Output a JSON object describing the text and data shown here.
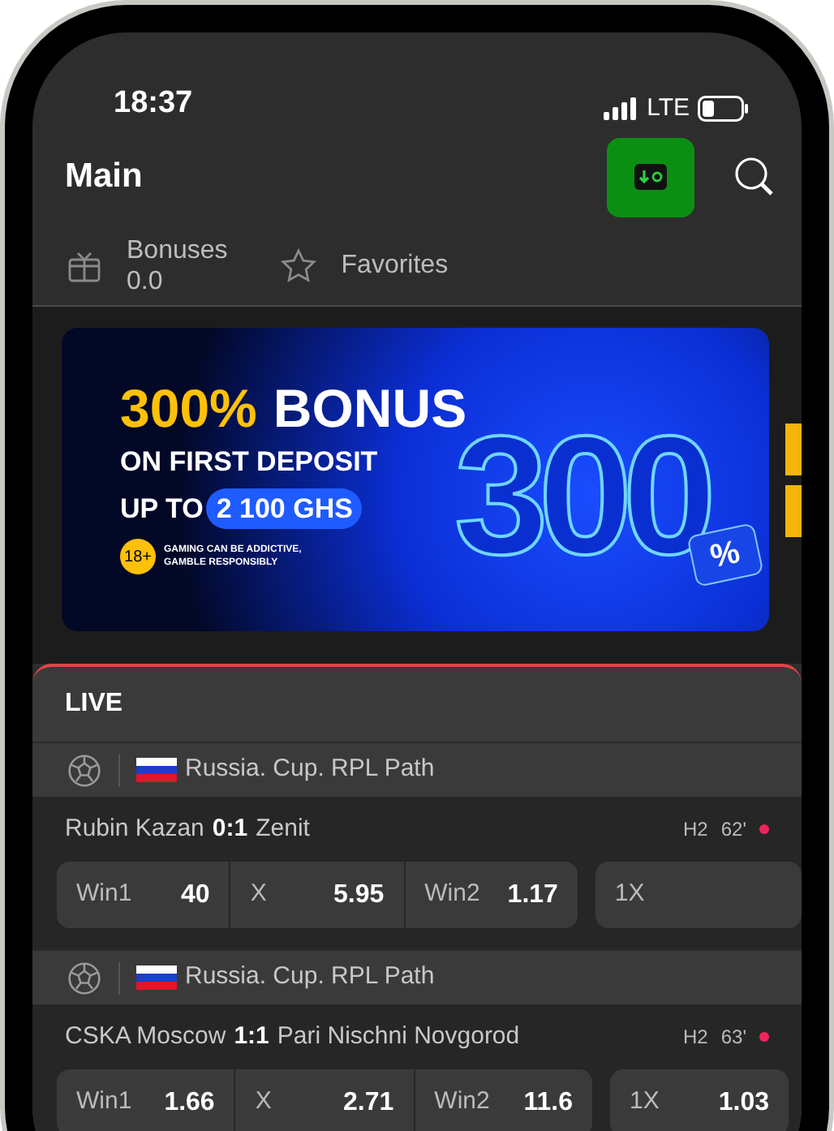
{
  "status_bar": {
    "time": "18:37",
    "network": "LTE"
  },
  "header": {
    "title": "Main"
  },
  "quick_links": [
    {
      "kind": "bonus",
      "label": "Bonuses",
      "value": "0.0"
    },
    {
      "kind": "favorites",
      "label": "Favorites"
    }
  ],
  "banner": {
    "headline_accent": "300%",
    "headline": "BONUS",
    "line_1": "ON FIRST DEPOSIT",
    "line_2": "UP TO",
    "amount": "2 100 GHS",
    "age": "18+",
    "warning": "GAMING CAN BE ADDICTIVE,\nGAMBLE RESPONSIBLY",
    "big_number": "300",
    "percent": "%"
  },
  "live": {
    "title": "LIVE",
    "events": [
      {
        "league": "Russia. Cup. RPL Path",
        "team_1": "Rubin Kazan",
        "score": "0:1",
        "team_2": "Zenit",
        "period": "H2",
        "minute": "62'",
        "odds": [
          {
            "label": "Win1",
            "value": "40"
          },
          {
            "label": "X",
            "value": "5.95"
          },
          {
            "label": "Win2",
            "value": "1.17"
          }
        ],
        "extra": {
          "label": "1X"
        }
      },
      {
        "league": "Russia. Cup. RPL Path",
        "team_1": "CSKA Moscow",
        "score": "1:1",
        "team_2": "Pari Nischni Novgorod",
        "period": "H2",
        "minute": "63'",
        "odds": [
          {
            "label": "Win1",
            "value": "1.66"
          },
          {
            "label": "X",
            "value": "2.71"
          },
          {
            "label": "Win2",
            "value": "11.6"
          }
        ],
        "extra": {
          "label": "1X",
          "value": "1.03"
        }
      }
    ]
  }
}
